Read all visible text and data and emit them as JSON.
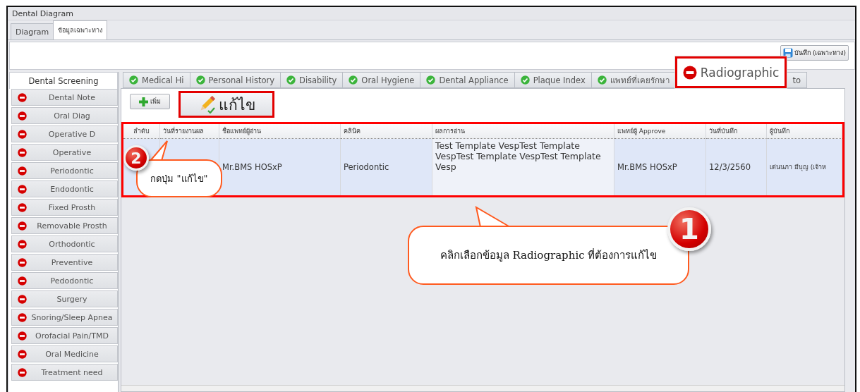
{
  "window": {
    "title": "Dental Diagram"
  },
  "outer_tabs": [
    {
      "label": "Diagram",
      "selected": false
    },
    {
      "label": "ข้อมูลเฉพาะทาง",
      "selected": true
    }
  ],
  "save_button": {
    "label": "บันทึก (เฉพาะทาง)"
  },
  "sidebar": {
    "header": "Dental Screening",
    "items": [
      {
        "label": "Dental Note",
        "complete": false
      },
      {
        "label": "Oral Diag",
        "complete": false
      },
      {
        "label": "Operative D",
        "complete": false
      },
      {
        "label": "Operative",
        "complete": false
      },
      {
        "label": "Periodontic",
        "complete": false
      },
      {
        "label": "Endodontic",
        "complete": false
      },
      {
        "label": "Fixed Prosth",
        "complete": false
      },
      {
        "label": "Removable Prosth",
        "complete": false
      },
      {
        "label": "Orthodontic",
        "complete": false
      },
      {
        "label": "Preventive",
        "complete": false
      },
      {
        "label": "Pedodontic",
        "complete": false
      },
      {
        "label": "Surgery",
        "complete": false
      },
      {
        "label": "Snoring/Sleep Apnea",
        "complete": false
      },
      {
        "label": "Orofacial Pain/TMD",
        "complete": false
      },
      {
        "label": "Oral Medicine",
        "complete": false
      },
      {
        "label": "Treatment need",
        "complete": false
      }
    ]
  },
  "tabs": [
    {
      "label": "Medical Hi",
      "complete": true,
      "selected": false
    },
    {
      "label": "Personal History",
      "complete": true,
      "selected": false
    },
    {
      "label": "Disability",
      "complete": true,
      "selected": false
    },
    {
      "label": "Oral Hygiene",
      "complete": true,
      "selected": false
    },
    {
      "label": "Dental Appliance",
      "complete": true,
      "selected": false
    },
    {
      "label": "Plaque Index",
      "complete": true,
      "selected": false
    },
    {
      "label": "แพทย์ที่เคยรักษา",
      "complete": true,
      "selected": false
    },
    {
      "label": "Radiographic",
      "complete": false,
      "selected": true
    },
    {
      "label": "to",
      "selected": false
    }
  ],
  "toolbar": {
    "add_button": "เพิ่ม",
    "edit_button": "แก้ไข"
  },
  "table": {
    "columns": [
      "ลำดับ",
      "วันที่รายงานผล",
      "ชื่อแพทย์ผู้อ่าน",
      "คลินิค",
      "ผลการอ่าน",
      "แพทย์ผู้ Approve",
      "วันที่บันทึก",
      "ผู้บันทึก"
    ],
    "rows": [
      {
        "selected": true,
        "cells": [
          null,
          null,
          "Mr.BMS HOSxP",
          "Periodontic",
          "Test Template VespTest Template VespTest Template VespTest Template Vesp",
          "Mr.BMS HOSxP",
          "12/3/2560",
          "เด่นนภา  มีบุญ (เจ้าห"
        ]
      }
    ]
  },
  "annotations": [
    {
      "number": "1",
      "text": "คลิกเลือกข้อมูล Radiographic ที่ต้องการแก้ไข"
    },
    {
      "number": "2",
      "text": "กดปุ่ม \"แก้ไข\""
    }
  ]
}
